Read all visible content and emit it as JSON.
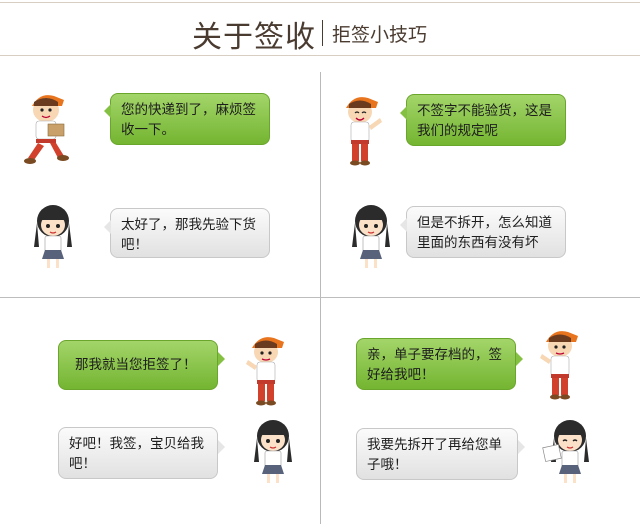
{
  "header": {
    "title": "关于签收",
    "subtitle": "拒签小技巧"
  },
  "panels": {
    "p1": {
      "courier": "您的快递到了，麻烦签收一下。",
      "customer": "太好了，那我先验下货吧！"
    },
    "p2": {
      "courier": "不签字不能验货，这是我们的规定呢",
      "customer": "但是不拆开，怎么知道里面的东西有没有坏"
    },
    "p3": {
      "customer": "那我就当您拒签了！",
      "courier": "好吧！我签，宝贝给我吧！"
    },
    "p4": {
      "customer": "亲，单子要存档的，签好给我吧！",
      "courier": "我要先拆开了再给您单子哦！"
    }
  },
  "colors": {
    "green_bubble": "#8cc84b",
    "grey_bubble": "#eeeeee",
    "title_color": "#4a3b30"
  }
}
